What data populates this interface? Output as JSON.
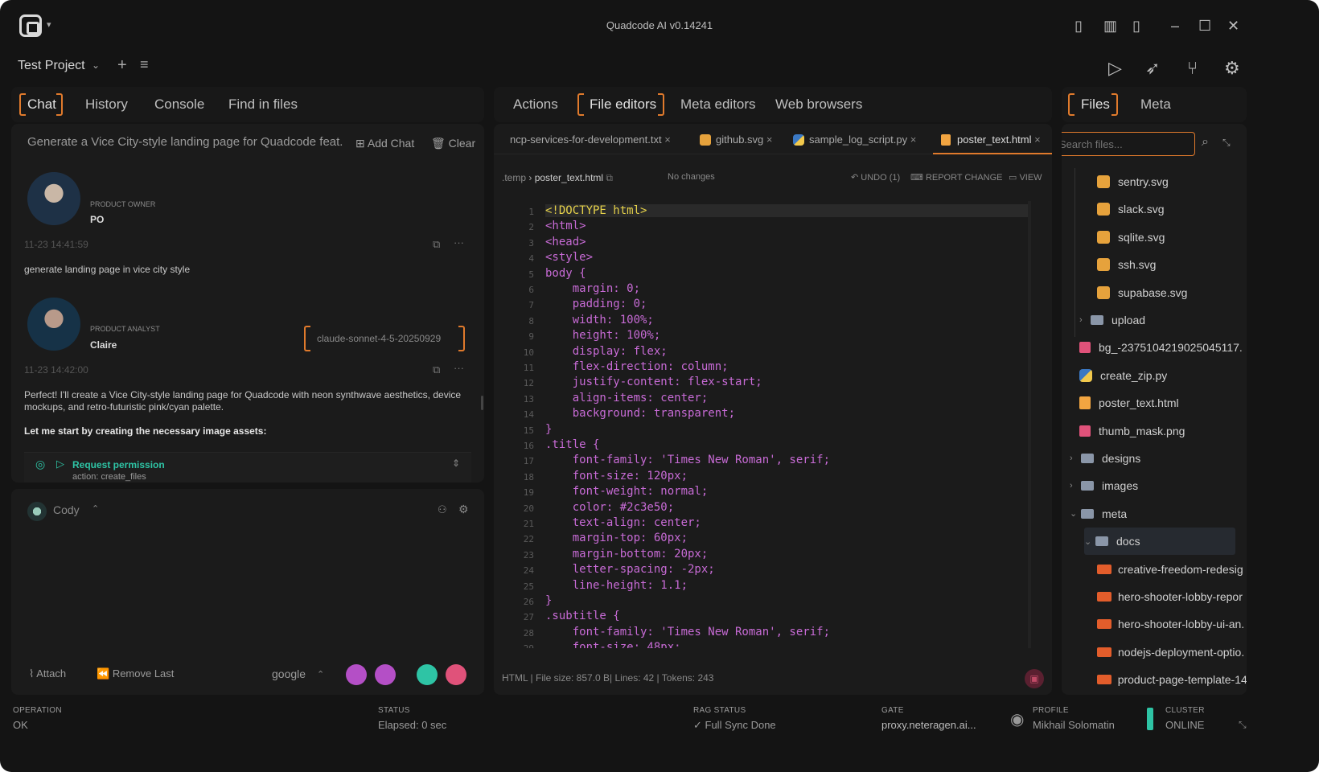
{
  "window": {
    "title": "Quadcode AI v0.14241",
    "project": "Test Project"
  },
  "left": {
    "tabs": [
      "Chat",
      "History",
      "Console",
      "Find in files"
    ],
    "chat_title": "Generate a Vice City-style landing page for Quadcode feat.",
    "add_chat": "Add Chat",
    "clear": "Clear",
    "messages": [
      {
        "role": "PRODUCT OWNER",
        "name": "PO",
        "time": "11-23 14:41:59",
        "text": "generate landing page in vice city style"
      },
      {
        "role": "PRODUCT ANALYST",
        "name": "Claire",
        "time": "11-23 14:42:00",
        "model": "claude-sonnet-4-5-20250929",
        "text": "Perfect! I'll create a Vice City-style landing page for Quadcode with neon synthwave aesthetics, device mockups, and retro-futuristic pink/cyan palette.",
        "bold": "Let me start by creating the necessary image assets:"
      }
    ],
    "permission": {
      "label": "Request permission",
      "action": "action: create_files"
    },
    "agent": "Cody",
    "attach": "Attach",
    "remove_last": "Remove Last",
    "provider": "google"
  },
  "center": {
    "tabs": [
      "Actions",
      "File editors",
      "Meta editors",
      "Web browsers"
    ],
    "file_tabs": [
      "ncp-services-for-development.txt",
      "github.svg",
      "sample_log_script.py",
      "poster_text.html"
    ],
    "breadcrumb": {
      "dir": ".temp",
      "file": "poster_text.html",
      "state": "No changes"
    },
    "actions": {
      "undo": "UNDO (1)",
      "report": "REPORT CHANGE",
      "view": "VIEW"
    },
    "code": [
      "<!DOCTYPE html>",
      "<html>",
      "<head>",
      "<style>",
      "body {",
      "    margin: 0;",
      "    padding: 0;",
      "    width: 100%;",
      "    height: 100%;",
      "    display: flex;",
      "    flex-direction: column;",
      "    justify-content: flex-start;",
      "    align-items: center;",
      "    background: transparent;",
      "}",
      ".title {",
      "    font-family: 'Times New Roman', serif;",
      "    font-size: 120px;",
      "    font-weight: normal;",
      "    color: #2c3e50;",
      "    text-align: center;",
      "    margin-top: 60px;",
      "    margin-bottom: 20px;",
      "    letter-spacing: -2px;",
      "    line-height: 1.1;",
      "}",
      ".subtitle {",
      "    font-family: 'Times New Roman', serif;",
      "    font-size: 48px;"
    ],
    "footer": "HTML | File size: 857.0 B| Lines: 42 | Tokens: 243"
  },
  "right": {
    "tabs": [
      "Files",
      "Meta"
    ],
    "search_placeholder": "Search files...",
    "tree": [
      {
        "name": "sentry.svg",
        "type": "svg",
        "indent": 2
      },
      {
        "name": "slack.svg",
        "type": "svg",
        "indent": 2
      },
      {
        "name": "sqlite.svg",
        "type": "svg",
        "indent": 2
      },
      {
        "name": "ssh.svg",
        "type": "svg",
        "indent": 2
      },
      {
        "name": "supabase.svg",
        "type": "svg",
        "indent": 2
      },
      {
        "name": "upload",
        "type": "folder",
        "indent": 1,
        "chev": "›"
      },
      {
        "name": "bg_-2375104219025045117.",
        "type": "img",
        "indent": 1
      },
      {
        "name": "create_zip.py",
        "type": "py",
        "indent": 1
      },
      {
        "name": "poster_text.html",
        "type": "html",
        "indent": 1
      },
      {
        "name": "thumb_mask.png",
        "type": "img",
        "indent": 1
      },
      {
        "name": "designs",
        "type": "folder",
        "indent": 0,
        "chev": "›"
      },
      {
        "name": "images",
        "type": "folder",
        "indent": 0,
        "chev": "›"
      },
      {
        "name": "meta",
        "type": "folder",
        "indent": 0,
        "chev": "⌄"
      },
      {
        "name": "docs",
        "type": "folder",
        "indent": 1,
        "chev": "⌄"
      },
      {
        "name": "creative-freedom-redesig",
        "type": "md",
        "indent": 2
      },
      {
        "name": "hero-shooter-lobby-repor",
        "type": "md",
        "indent": 2
      },
      {
        "name": "hero-shooter-lobby-ui-an.",
        "type": "md",
        "indent": 2
      },
      {
        "name": "nodejs-deployment-optio.",
        "type": "md",
        "indent": 2
      },
      {
        "name": "product-page-template-14",
        "type": "md",
        "indent": 2
      }
    ]
  },
  "status": {
    "operation_label": "OPERATION",
    "operation": "OK",
    "status_label": "STATUS",
    "status": "Elapsed: 0 sec",
    "rag_label": "RAG STATUS",
    "rag": "✓ Full Sync Done",
    "gate_label": "GATE",
    "gate": "proxy.neteragen.ai...",
    "profile_label": "PROFILE",
    "profile": "Mikhail Solomatin",
    "cluster_label": "CLUSTER",
    "cluster": "ONLINE"
  },
  "colors": {
    "accent": "#e07a2c",
    "teal": "#2ec4a5",
    "purple": "#b44fc6",
    "red": "#e0527a"
  }
}
